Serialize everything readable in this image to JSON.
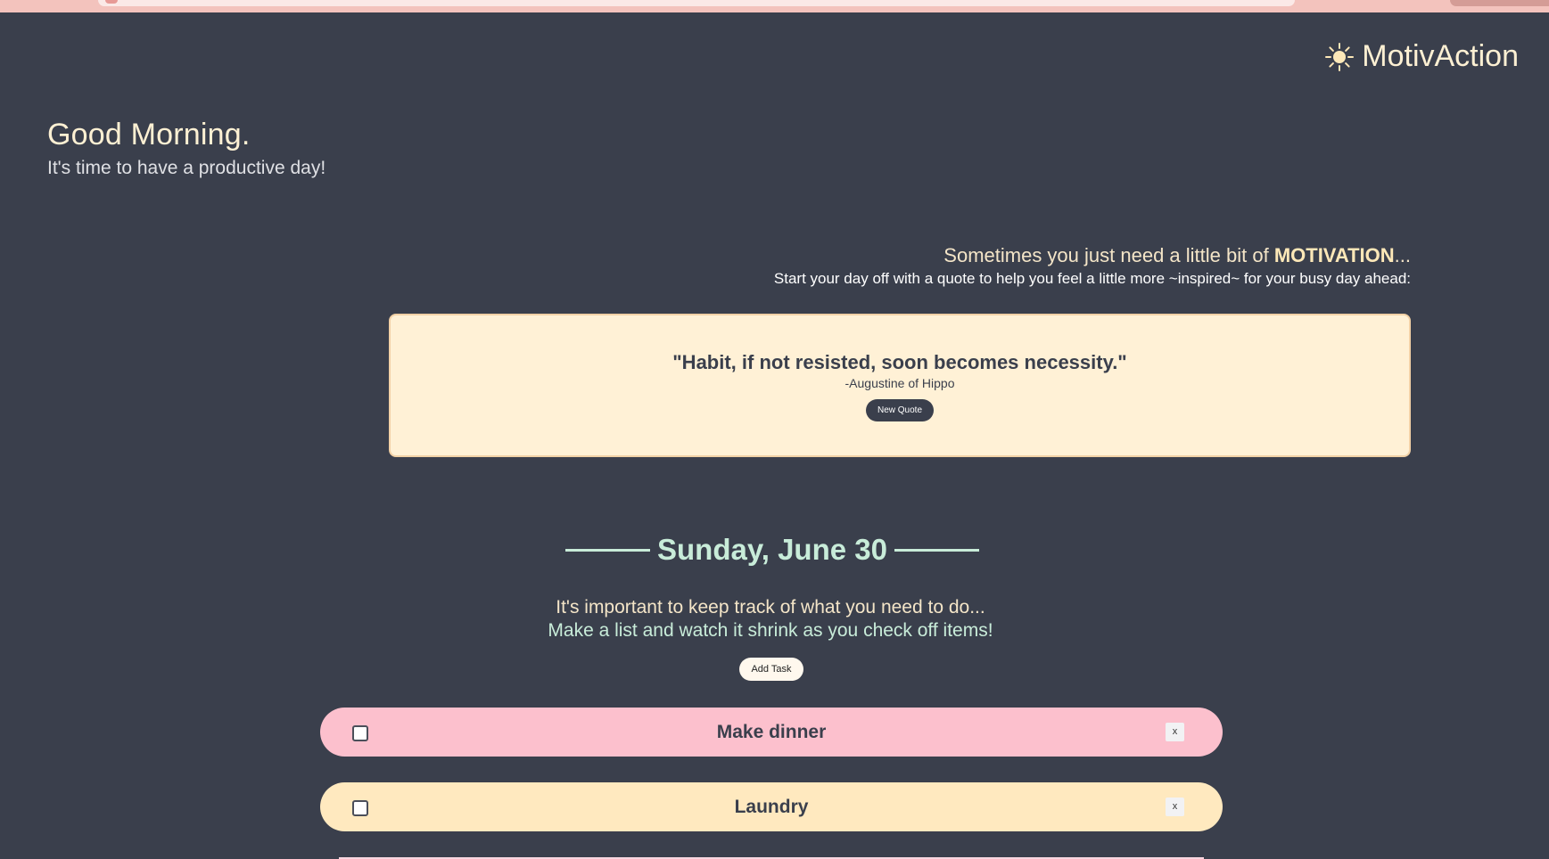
{
  "brand": {
    "name": "MotivAction",
    "icon": "sun-icon"
  },
  "greeting": {
    "title": "Good Morning.",
    "subtitle": "It's time to have a productive day!"
  },
  "motivation": {
    "lead": "Sometimes you just need a little bit of ",
    "emphasis": "MOTIVATION",
    "ellipsis": "...",
    "subtitle": "Start your day off with a quote to help you feel a little more ~inspired~ for your busy day ahead:"
  },
  "quote": {
    "text": "\"Habit, if not resisted, soon becomes necessity.\"",
    "author": "-Augustine of Hippo",
    "button_label": "New Quote"
  },
  "date": {
    "label": "Sunday, June 30"
  },
  "todo": {
    "intro_line1": "It's important to keep track of what you need to do...",
    "intro_line2": "Make a list and watch it shrink as you check off items!",
    "add_label": "Add Task",
    "tasks": [
      {
        "label": "Make dinner",
        "delete_label": "x",
        "checked": false,
        "color": "#fcc0cd"
      },
      {
        "label": "Laundry",
        "delete_label": "x",
        "checked": false,
        "color": "#ffe9bf"
      }
    ]
  },
  "colors": {
    "background": "#3a3f4c",
    "cream": "#fdf0d3",
    "mint": "#c8ecd9",
    "quote_card": "#fff1d6"
  }
}
